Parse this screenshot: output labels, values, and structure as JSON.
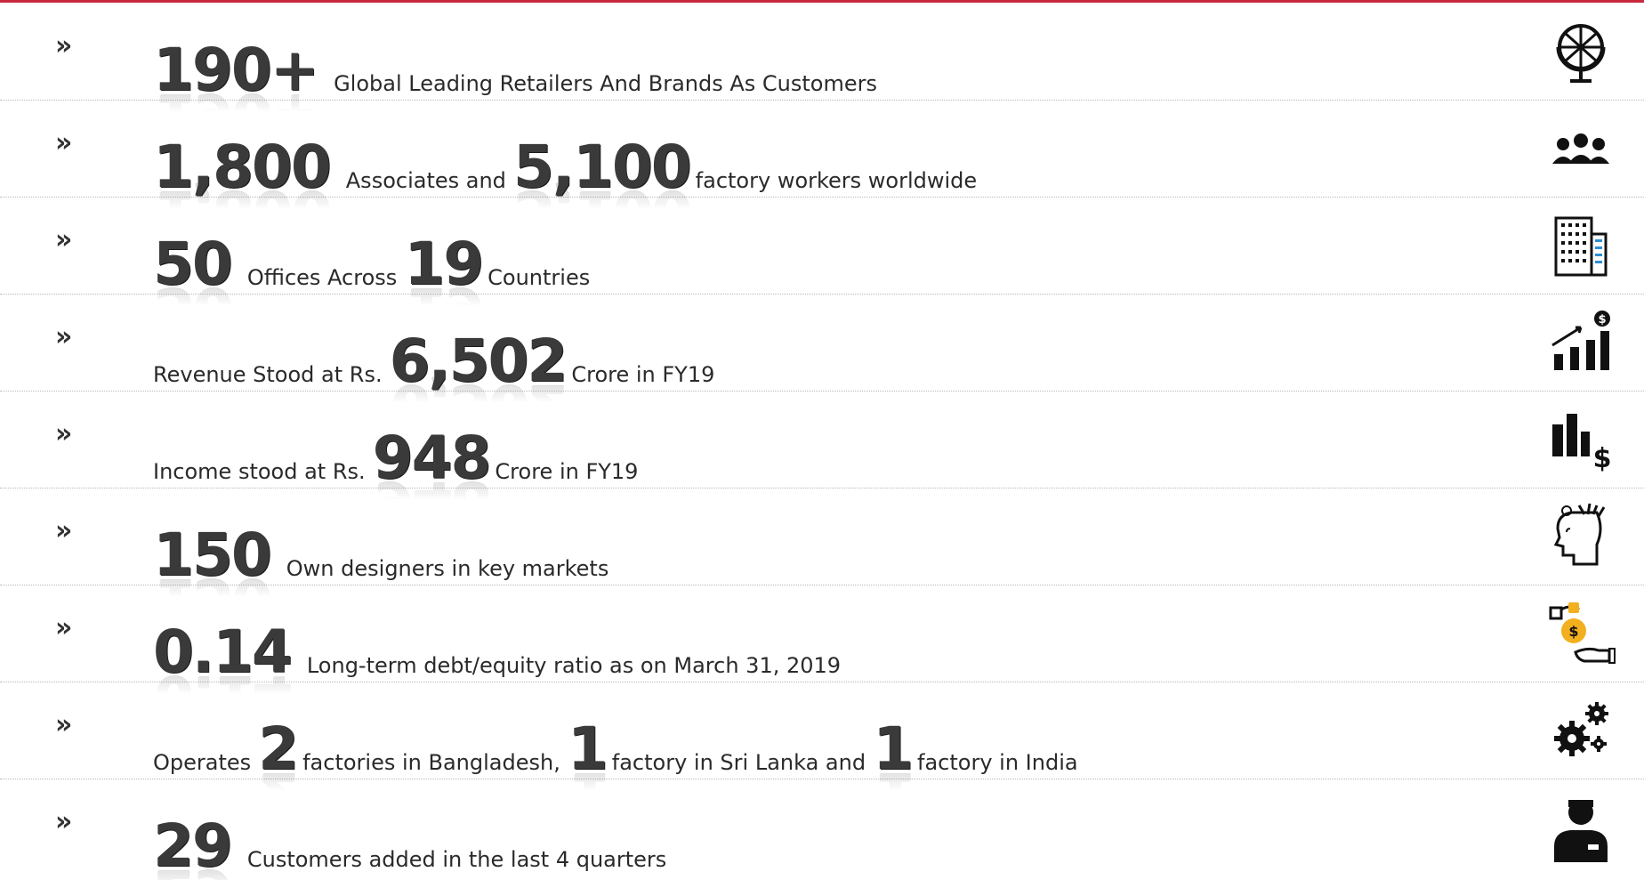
{
  "rows": [
    {
      "bullet": "»",
      "num1": "190+",
      "text1": "Global Leading Retailers And Brands As Customers",
      "icon": "globe-icon"
    },
    {
      "bullet": "»",
      "num1": "1,800",
      "text1": "Associates and",
      "num2": "5,100",
      "text2": "factory workers worldwide",
      "icon": "people-group-icon"
    },
    {
      "bullet": "»",
      "num1": "50",
      "text1": "Offices Across",
      "num2": "19",
      "text2": "Countries",
      "icon": "office-building-icon"
    },
    {
      "bullet": "»",
      "text0": "Revenue Stood at Rs.",
      "num1": "6,502",
      "text1": "Crore in FY19",
      "icon": "revenue-growth-icon"
    },
    {
      "bullet": "»",
      "text0": "Income stood at Rs.",
      "num1": "948",
      "text1": "Crore in FY19",
      "icon": "income-chart-dollar-icon"
    },
    {
      "bullet": "»",
      "num1": "150",
      "text1": "Own designers in key markets",
      "icon": "designer-head-icon"
    },
    {
      "bullet": "»",
      "num1": "0.14",
      "text1": "Long-term debt/equity ratio as on March 31, 2019",
      "icon": "debt-equity-hand-icon"
    },
    {
      "bullet": "»",
      "text0": "Operates",
      "num1": "2",
      "text1": "factories in Bangladesh,",
      "num2": "1",
      "text2": "factory in Sri Lanka and",
      "num3": "1",
      "text3": "factory in India",
      "icon": "gears-icon"
    },
    {
      "bullet": "»",
      "num1": "29",
      "text1": "Customers added in the last 4 quarters",
      "icon": "customer-person-icon"
    }
  ],
  "colors": {
    "accent": "#c8283d",
    "number": "#3a3a3a",
    "icon_blue": "#2b8fd6",
    "icon_gold": "#f2b01e"
  }
}
